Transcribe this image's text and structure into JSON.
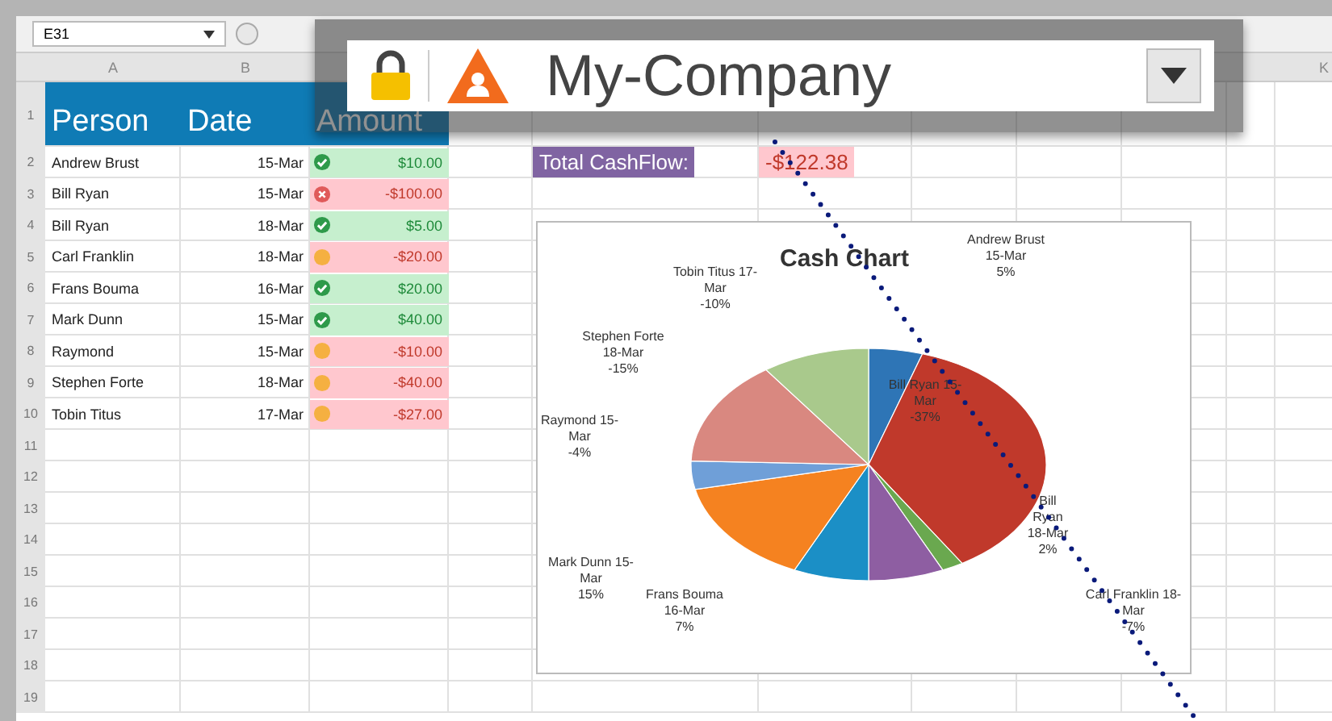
{
  "formula_bar": {
    "name_box": "E31"
  },
  "overlay": {
    "company": "My-Company"
  },
  "sheet": {
    "column_headers": [
      "A",
      "B",
      "K"
    ],
    "row_numbers": [
      "1",
      "2",
      "3",
      "4",
      "5",
      "6",
      "7",
      "8",
      "9",
      "10",
      "11",
      "12",
      "13",
      "14",
      "15",
      "16",
      "17",
      "18",
      "19"
    ],
    "header": [
      "Person",
      "Date",
      "Amount"
    ],
    "rows": [
      {
        "person": "Andrew Brust",
        "date": "15-Mar",
        "kind": "ok",
        "amount": "$10.00"
      },
      {
        "person": "Bill Ryan",
        "date": "15-Mar",
        "kind": "bad",
        "amount": "-$100.00"
      },
      {
        "person": "Bill Ryan",
        "date": "18-Mar",
        "kind": "ok",
        "amount": "$5.00"
      },
      {
        "person": "Carl Franklin",
        "date": "18-Mar",
        "kind": "warn",
        "amount": "-$20.00"
      },
      {
        "person": "Frans Bouma",
        "date": "16-Mar",
        "kind": "ok",
        "amount": "$20.00"
      },
      {
        "person": "Mark Dunn",
        "date": "15-Mar",
        "kind": "ok",
        "amount": "$40.00"
      },
      {
        "person": "Raymond",
        "date": "15-Mar",
        "kind": "warn",
        "amount": "-$10.00"
      },
      {
        "person": "Stephen Forte",
        "date": "18-Mar",
        "kind": "warn",
        "amount": "-$40.00"
      },
      {
        "person": "Tobin Titus",
        "date": "17-Mar",
        "kind": "warn",
        "amount": "-$27.00"
      }
    ],
    "summary": {
      "label": "Total CashFlow:",
      "value": "-$122.38"
    },
    "chart": {
      "title": "Cash Chart",
      "labels": [
        {
          "name": "Andrew Brust 15-Mar",
          "percent": "5%"
        },
        {
          "name": "Tobin Titus 17-Mar",
          "percent": "-10%"
        },
        {
          "name": "Stephen Forte 18-Mar",
          "percent": "-15%"
        },
        {
          "name": "Bill Ryan 15-Mar",
          "percent": "-37%"
        },
        {
          "name": "Raymond 15-Mar",
          "percent": "-4%"
        },
        {
          "name": "Bill Ryan 18-Mar",
          "percent": "2%"
        },
        {
          "name": "Mark Dunn 15-Mar",
          "percent": "15%"
        },
        {
          "name": "Frans Bouma 16-Mar",
          "percent": "7%"
        },
        {
          "name": "Carl Franklin 18-Mar",
          "percent": "-7%"
        }
      ]
    }
  }
}
